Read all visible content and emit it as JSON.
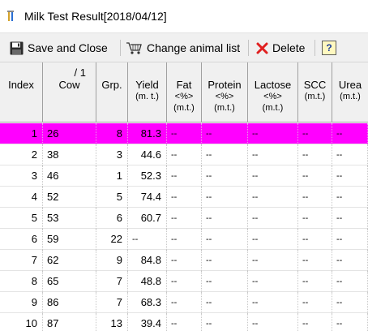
{
  "window": {
    "title": "Milk Test Result[2018/04/12]"
  },
  "toolbar": {
    "save_label": "Save and Close",
    "change_label": "Change animal list",
    "delete_label": "Delete",
    "help_label": "?"
  },
  "columns": {
    "index": "Index",
    "cow_top": "/ 1",
    "cow": "Cow",
    "grp": "Grp.",
    "yield": "Yield",
    "yield_unit": "(m. t.)",
    "fat": "Fat",
    "fat_unit": "<%>",
    "fat_mt": "(m.t.)",
    "protein": "Protein",
    "protein_unit": "<%>",
    "protein_mt": "(m.t.)",
    "lactose": "Lactose",
    "lactose_unit": "<%>",
    "lactose_mt": "(m.t.)",
    "scc": "SCC",
    "scc_unit": "(m.t.)",
    "urea": "Urea",
    "urea_unit": "(m.t.)"
  },
  "rows": [
    {
      "index": "1",
      "cow": "26",
      "grp": "8",
      "yield": "81.3",
      "fat": "--",
      "protein": "--",
      "lactose": "--",
      "scc": "--",
      "urea": "--",
      "selected": true
    },
    {
      "index": "2",
      "cow": "38",
      "grp": "3",
      "yield": "44.6",
      "fat": "--",
      "protein": "--",
      "lactose": "--",
      "scc": "--",
      "urea": "--"
    },
    {
      "index": "3",
      "cow": "46",
      "grp": "1",
      "yield": "52.3",
      "fat": "--",
      "protein": "--",
      "lactose": "--",
      "scc": "--",
      "urea": "--"
    },
    {
      "index": "4",
      "cow": "52",
      "grp": "5",
      "yield": "74.4",
      "fat": "--",
      "protein": "--",
      "lactose": "--",
      "scc": "--",
      "urea": "--"
    },
    {
      "index": "5",
      "cow": "53",
      "grp": "6",
      "yield": "60.7",
      "fat": "--",
      "protein": "--",
      "lactose": "--",
      "scc": "--",
      "urea": "--"
    },
    {
      "index": "6",
      "cow": "59",
      "grp": "22",
      "yield": "--",
      "fat": "--",
      "protein": "--",
      "lactose": "--",
      "scc": "--",
      "urea": "--"
    },
    {
      "index": "7",
      "cow": "62",
      "grp": "9",
      "yield": "84.8",
      "fat": "--",
      "protein": "--",
      "lactose": "--",
      "scc": "--",
      "urea": "--"
    },
    {
      "index": "8",
      "cow": "65",
      "grp": "7",
      "yield": "48.8",
      "fat": "--",
      "protein": "--",
      "lactose": "--",
      "scc": "--",
      "urea": "--"
    },
    {
      "index": "9",
      "cow": "86",
      "grp": "7",
      "yield": "68.3",
      "fat": "--",
      "protein": "--",
      "lactose": "--",
      "scc": "--",
      "urea": "--"
    },
    {
      "index": "10",
      "cow": "87",
      "grp": "13",
      "yield": "39.4",
      "fat": "--",
      "protein": "--",
      "lactose": "--",
      "scc": "--",
      "urea": "--"
    }
  ],
  "colors": {
    "selected_row": "#ff00ff",
    "delete_icon": "#e02020"
  },
  "icons": {
    "app": "milk-bottle-icon",
    "save": "floppy-disk-icon",
    "change": "cart-icon",
    "delete": "red-x-icon",
    "help": "help-icon"
  }
}
